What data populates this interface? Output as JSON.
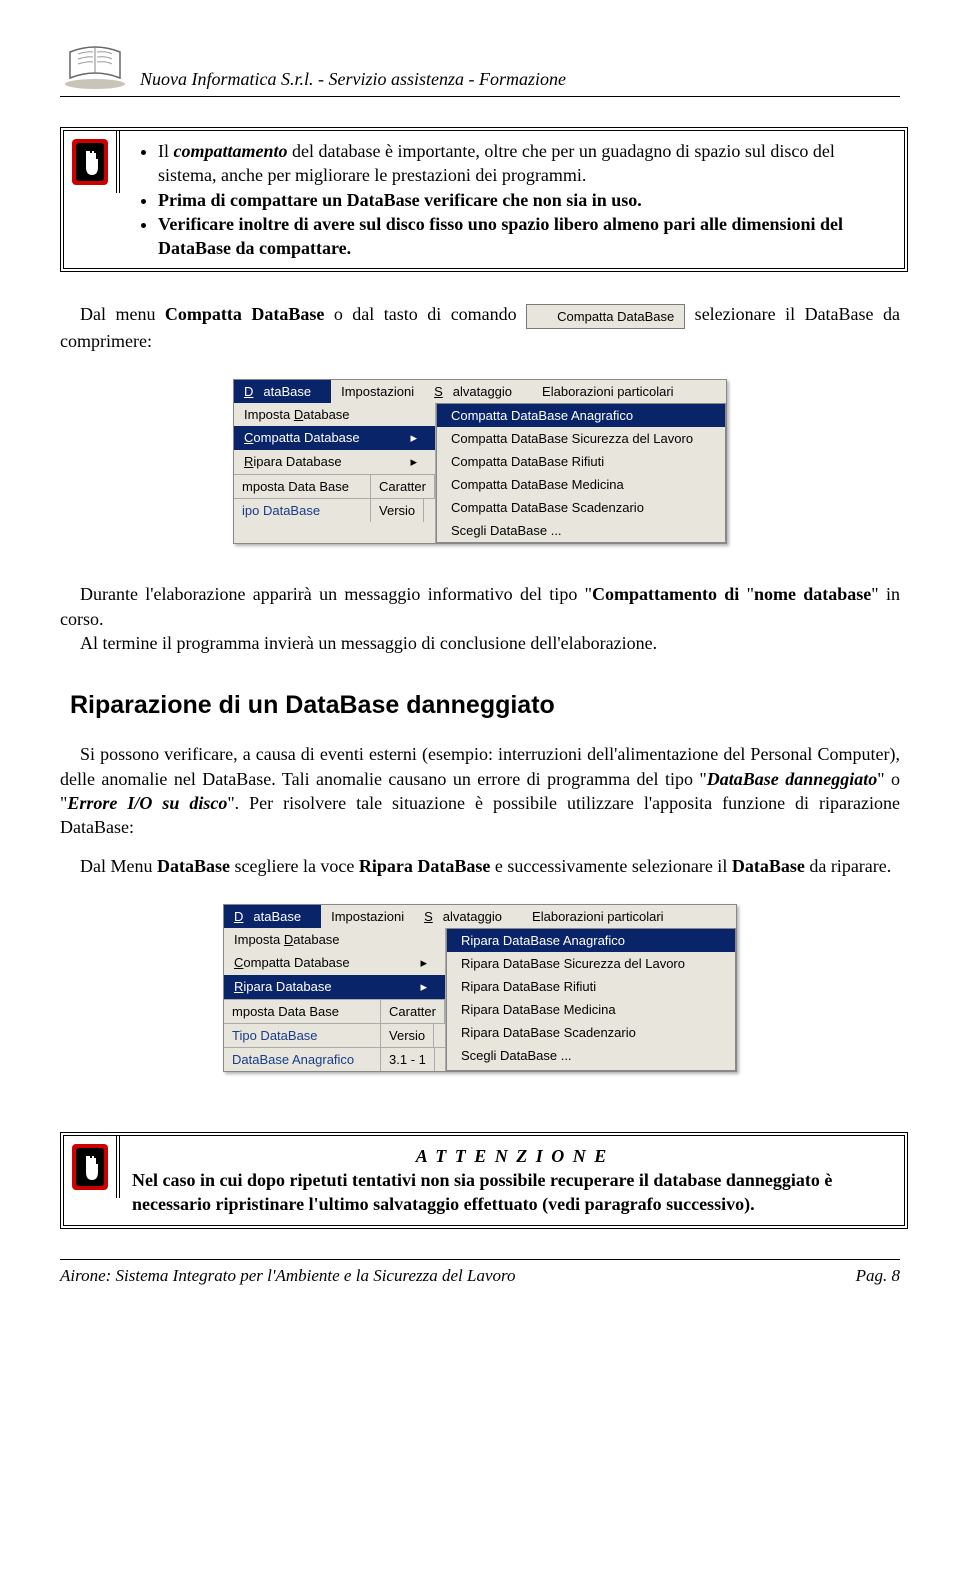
{
  "header": {
    "company": "Nuova Informatica S.r.l.",
    "separator": "  -   ",
    "service": "Servizio assistenza - Formazione"
  },
  "warning1": {
    "bullets": [
      {
        "pre": "Il ",
        "b1": "compattamento",
        "mid": " del database è importante, oltre che per un guadagno di spazio sul disco del sistema, anche per migliorare le prestazioni dei programmi."
      },
      {
        "text": "Prima di compattare un DataBase verificare che non sia in uso."
      },
      {
        "text": "Verificare inoltre di avere sul disco fisso uno spazio libero almeno pari alle dimensioni del DataBase da compattare."
      }
    ]
  },
  "para1": {
    "pre": "Dal menu ",
    "b1": "Compatta DataBase",
    "mid": " o dal tasto di comando ",
    "button": "Compatta DataBase",
    "after": " selezionare il DataBase da comprimere:"
  },
  "menu1": {
    "menubar": [
      "DataBase",
      "Impostazioni",
      "Salvataggio",
      "Elaborazioni particolari"
    ],
    "menubar_selected": 0,
    "left_items": [
      "Imposta Database",
      "Compatta Database",
      "Ripara Database"
    ],
    "left_selected": 1,
    "submenu": [
      "Compatta DataBase Anagrafico",
      "Compatta DataBase Sicurezza del Lavoro",
      "Compatta DataBase Rifiuti",
      "Compatta DataBase Medicina",
      "Compatta DataBase Scadenzario",
      "Scegli DataBase ..."
    ],
    "submenu_selected": 0,
    "toolbar": [
      [
        "mposta Data Base",
        "Caratter"
      ],
      [
        "ipo DataBase",
        "Versio"
      ]
    ]
  },
  "para2": {
    "pre": "Durante l'elaborazione apparirà un messaggio informativo del tipo \"",
    "b1": "Compattamento di",
    "mid": " \"",
    "b2": "nome database",
    "after": "\" in corso.",
    "line2": "Al termine il programma invierà un messaggio di conclusione dell'elaborazione."
  },
  "heading2": "Riparazione di un  DataBase danneggiato",
  "para3": {
    "text": "Si possono verificare, a causa di eventi esterni (esempio: interruzioni dell'alimentazione del Personal Computer), delle anomalie nel DataBase. Tali anomalie causano un errore di programma del tipo \"",
    "bi1": "DataBase danneggiato",
    "mid1": "\" o \"",
    "bi2": "Errore I/O su disco",
    "after": "\". Per risolvere tale situazione è possibile utilizzare l'apposita funzione di riparazione DataBase:"
  },
  "para4": {
    "pre": "Dal Menu ",
    "b1": "DataBase",
    "mid1": " scegliere la voce ",
    "b2": "Ripara DataBase",
    "mid2": " e successivamente selezionare il ",
    "b3": "DataBase",
    "after": " da riparare."
  },
  "menu2": {
    "menubar": [
      "DataBase",
      "Impostazioni",
      "Salvataggio",
      "Elaborazioni particolari"
    ],
    "menubar_selected": 0,
    "left_items": [
      "Imposta Database",
      "Compatta Database",
      "Ripara Database"
    ],
    "left_selected": 2,
    "submenu": [
      "Ripara DataBase Anagrafico",
      "Ripara DataBase Sicurezza del Lavoro",
      "Ripara DataBase Rifiuti",
      "Ripara DataBase Medicina",
      "Ripara DataBase Scadenzario",
      "Scegli DataBase ..."
    ],
    "submenu_selected": 0,
    "toolbar": [
      [
        "mposta Data Base",
        "Caratter"
      ],
      [
        "Tipo DataBase",
        "Versio"
      ],
      [
        "DataBase Anagrafico",
        "3.1 - 1"
      ]
    ]
  },
  "warning2": {
    "title": "A T T E N Z I O N E",
    "text": "Nel caso in cui dopo ripetuti tentativi  non sia possibile recuperare il database danneggiato è necessario ripristinare l'ultimo salvataggio effettuato (vedi paragrafo successivo)."
  },
  "footer": {
    "left": "Airone: Sistema Integrato per l'Ambiente e la Sicurezza del Lavoro",
    "right": "Pag. 8"
  }
}
